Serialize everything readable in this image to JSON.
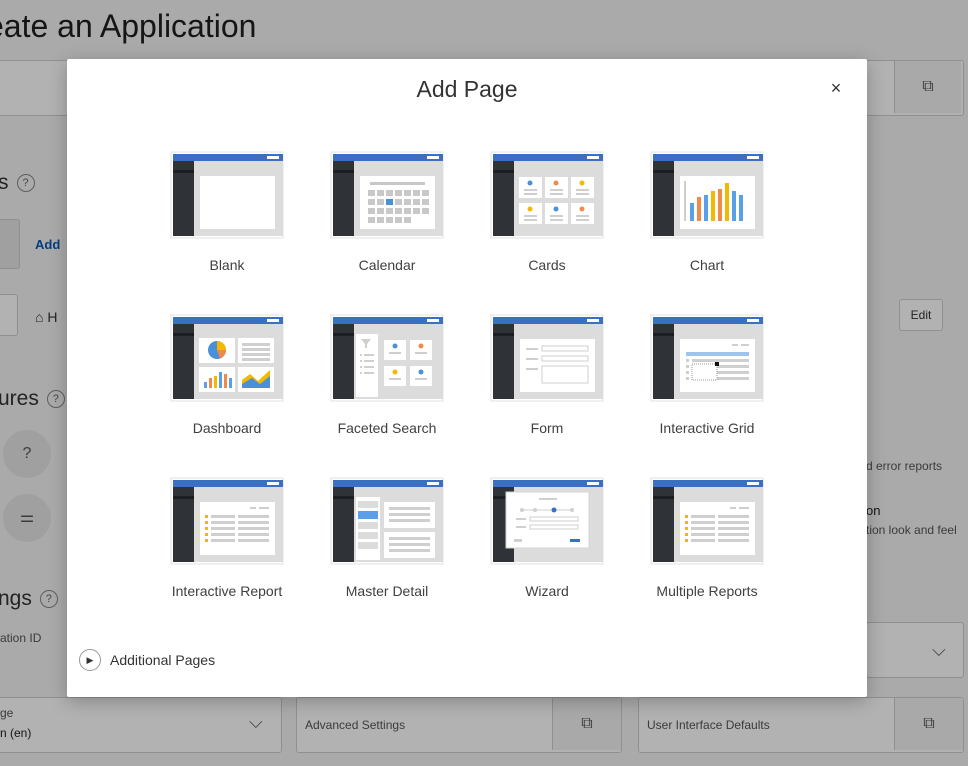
{
  "background": {
    "page_title": "eate an Application",
    "section_pages": "s",
    "add_label": "Add",
    "home_label": "H",
    "edit_label": "Edit",
    "section_features": "ures",
    "section_settings": "ngs",
    "app_id_label": "ation ID",
    "error_reports_text": "d error reports",
    "feature_title_partial": "on",
    "look_feel_text": "tion look and feel",
    "lang_label": "ge",
    "lang_value": "n (en)",
    "advanced_settings": "Advanced Settings",
    "ui_defaults": "User Interface Defaults"
  },
  "modal": {
    "title": "Add Page",
    "close_symbol": "×",
    "tiles": [
      {
        "label": "Blank",
        "icon": "blank-page-icon"
      },
      {
        "label": "Calendar",
        "icon": "calendar-page-icon"
      },
      {
        "label": "Cards",
        "icon": "cards-page-icon"
      },
      {
        "label": "Chart",
        "icon": "chart-page-icon"
      },
      {
        "label": "Dashboard",
        "icon": "dashboard-page-icon"
      },
      {
        "label": "Faceted Search",
        "icon": "faceted-search-page-icon"
      },
      {
        "label": "Form",
        "icon": "form-page-icon"
      },
      {
        "label": "Interactive Grid",
        "icon": "interactive-grid-page-icon"
      },
      {
        "label": "Interactive Report",
        "icon": "interactive-report-page-icon"
      },
      {
        "label": "Master Detail",
        "icon": "master-detail-page-icon"
      },
      {
        "label": "Wizard",
        "icon": "wizard-page-icon"
      },
      {
        "label": "Multiple Reports",
        "icon": "multiple-reports-page-icon"
      }
    ],
    "additional_pages": "Additional Pages"
  },
  "colors": {
    "accent_blue": "#3a6fc4",
    "sidebar_dark": "#2f3237",
    "thumb_gray": "#dcdcdc"
  }
}
